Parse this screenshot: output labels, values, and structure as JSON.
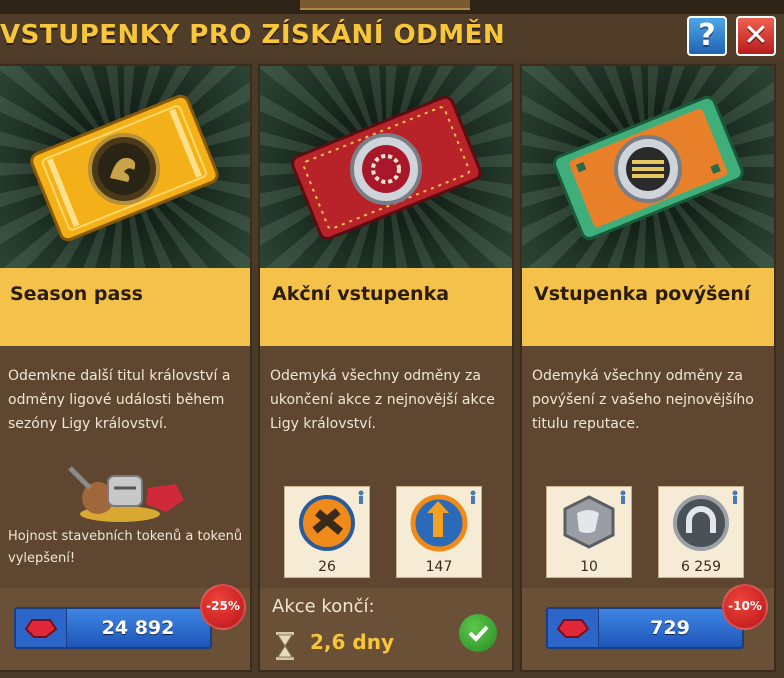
{
  "title": "VSTUPENKY PRO ZÍSKÁNÍ ODMĚN",
  "header_buttons": {
    "help_label": "?",
    "close_label": "✕"
  },
  "cards": [
    {
      "name": "Season pass",
      "description": "Odemkne další titul království a odměny ligové události během sezóny Ligy království.",
      "extra": "Hojnost stavebních tokenů a tokenů vylepšení!",
      "price": "24 892",
      "discount": "-25%",
      "ticket_icon": "dragon-emblem-icon",
      "accent": "#f2a81a"
    },
    {
      "name": "Akční vstupenka",
      "description": "Odemyká všechny odměny za ukončení akce z nejnovější akce Ligy království.",
      "rewards": [
        {
          "icon": "hammer-token-icon",
          "count": "26"
        },
        {
          "icon": "upgrade-token-icon",
          "count": "147"
        }
      ],
      "ends_label": "Akce končí:",
      "ends_value": "2,6 dny",
      "ticket_icon": "laurel-wreath-icon",
      "accent": "#b8232a"
    },
    {
      "name": "Vstupenka povýšení",
      "description": "Odemyká všechny odměny za povýšení z vašeho nejnovějšího titulu reputace.",
      "rewards": [
        {
          "icon": "armor-plate-icon",
          "count": "10"
        },
        {
          "icon": "horseshoe-icon",
          "count": "6 259"
        }
      ],
      "price": "729",
      "discount": "-10%",
      "ticket_icon": "striped-shield-icon",
      "accent": "#3fae7a"
    }
  ],
  "colors": {
    "gold_title": "#f7c63a",
    "name_bar": "#f4c24a",
    "buy_button": "#2f6fd0",
    "discount_badge": "#d8262a"
  }
}
